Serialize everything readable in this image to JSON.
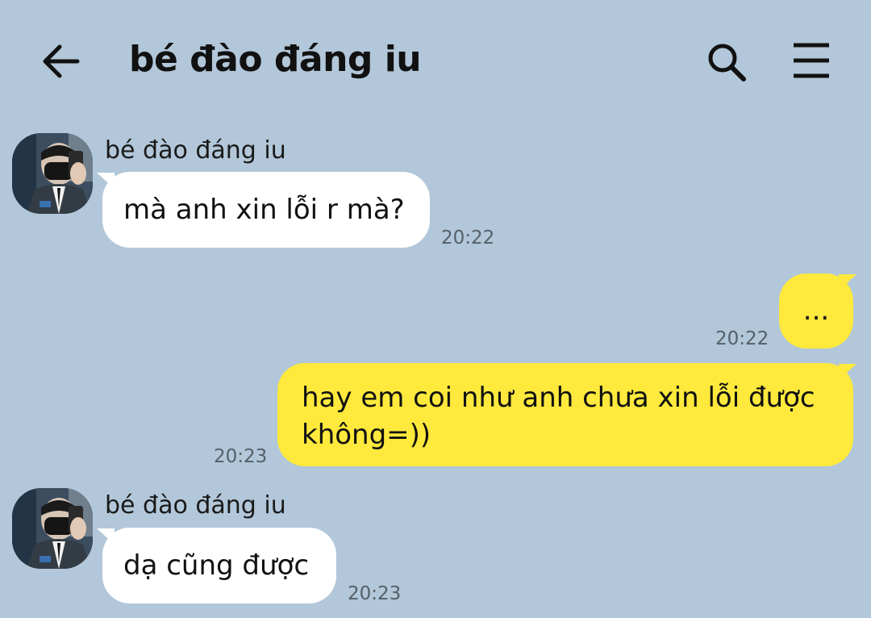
{
  "header": {
    "title": "bé đào đáng iu",
    "back_icon": "arrow-left-icon",
    "search_icon": "search-icon",
    "menu_icon": "hamburger-menu-icon"
  },
  "colors": {
    "background": "#b2c7d9",
    "incoming_bubble": "#ffffff",
    "outgoing_bubble": "#fee93c",
    "timestamp": "#555f68"
  },
  "messages": [
    {
      "direction": "incoming",
      "sender": "bé đào đáng iu",
      "text": "mà anh xin lỗi r mà?",
      "time": "20:22"
    },
    {
      "direction": "outgoing",
      "text": "...",
      "time": "20:22"
    },
    {
      "direction": "outgoing",
      "text_lines": [
        "hay em coi như anh chưa xin lỗi được",
        "không=))"
      ],
      "time": "20:23"
    },
    {
      "direction": "incoming",
      "sender": "bé đào đáng iu",
      "text": "dạ cũng được",
      "time": "20:23"
    }
  ]
}
